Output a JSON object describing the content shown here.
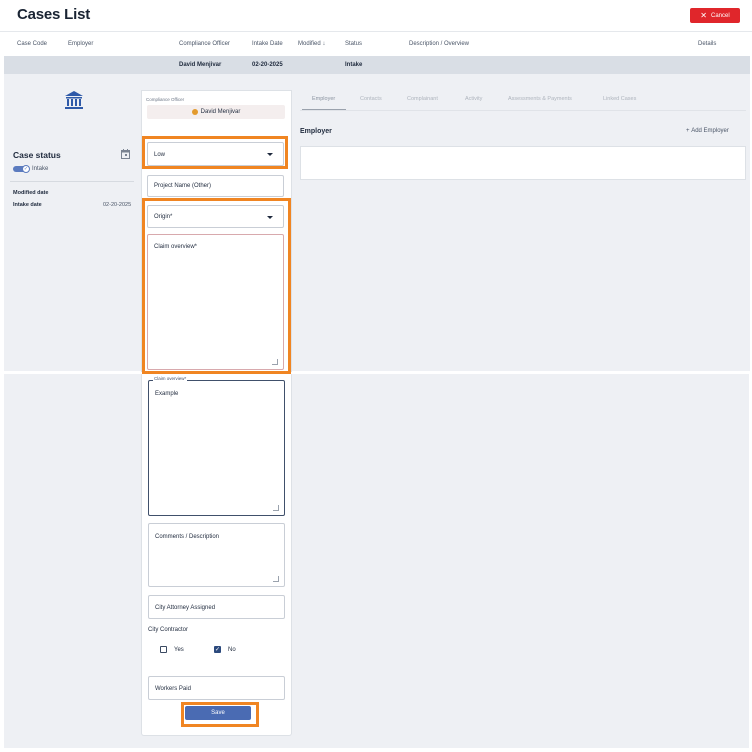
{
  "header": {
    "title": "Cases List",
    "cancel_label": "Cancel"
  },
  "table": {
    "columns": [
      "Case Code",
      "Employer",
      "Compliance Officer",
      "Intake Date",
      "Modified ↓",
      "Status",
      "Description / Overview",
      "Details"
    ],
    "row": {
      "officer": "David Menjivar",
      "intake_date": "02-20-2025",
      "status": "Intake"
    }
  },
  "left_panel": {
    "case_status_title": "Case status",
    "status_value": "Intake",
    "modified_label": "Modified date",
    "intake_label": "Intake date",
    "intake_value": "02-20-2025"
  },
  "form": {
    "officer_caption": "Compliance Officer",
    "officer_name": "David Menjivar",
    "priority_value": "Low",
    "project_name_placeholder": "Project Name (Other)",
    "origin_placeholder": "Origin*",
    "claim_placeholder": "Claim overview*",
    "claim_legend": "Claim overview*",
    "claim_value": "Example",
    "comments_placeholder": "Comments / Description",
    "city_attorney_placeholder": "City Attorney Assigned",
    "city_contractor_label": "City Contractor",
    "yes_label": "Yes",
    "no_label": "No",
    "yes_checked": false,
    "no_checked": true,
    "workers_paid_placeholder": "Workers Paid",
    "save_label": "Save"
  },
  "tabs": [
    "Employer",
    "Contacts",
    "Complainant",
    "Activity",
    "Assessments & Payments",
    "Linked Cases"
  ],
  "employer_section": {
    "heading": "Employer",
    "add_label": "Add Employer"
  },
  "colors": {
    "accent": "#4a6bb3",
    "cancel": "#e0262b",
    "highlight": "#f08522"
  }
}
